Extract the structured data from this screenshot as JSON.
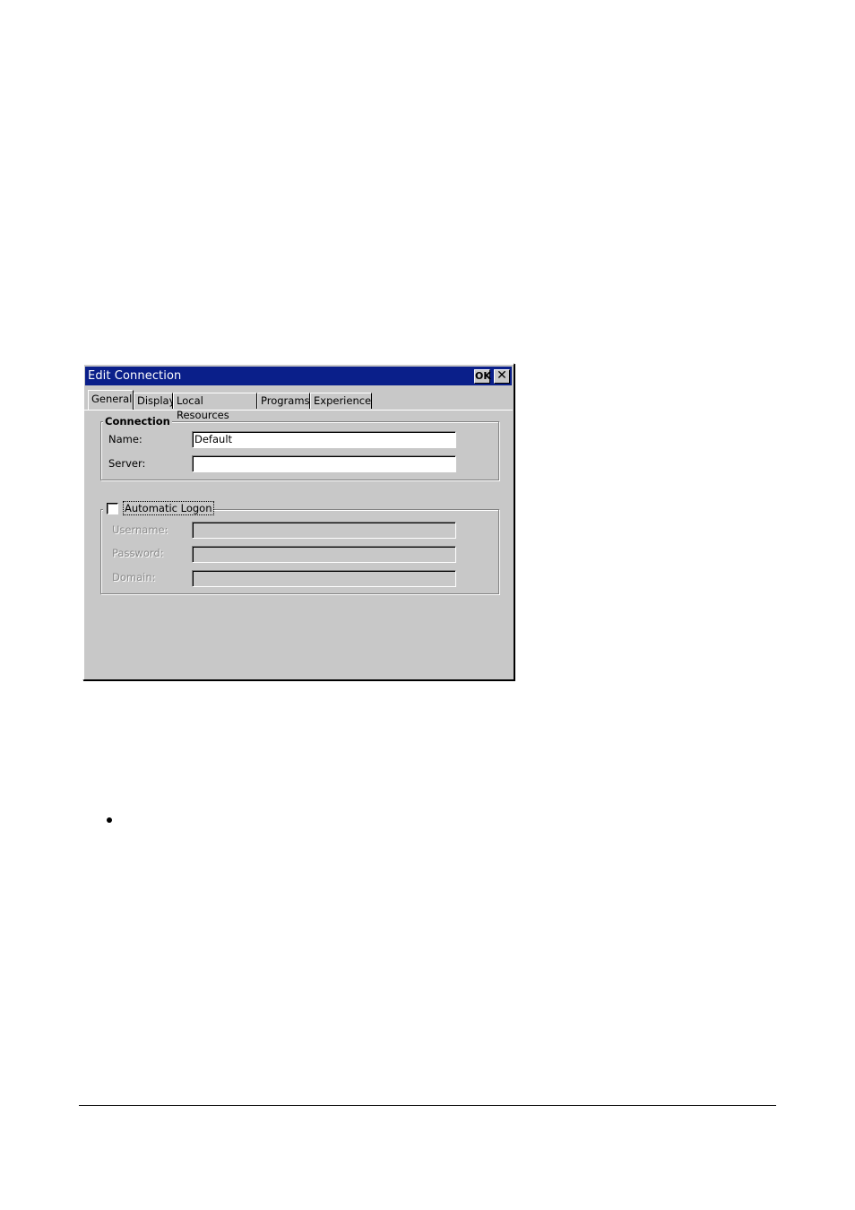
{
  "window": {
    "title": "Edit Connection",
    "ok_label": "OK",
    "close_symbol": "✕"
  },
  "tabs": [
    {
      "label": "General",
      "active": true
    },
    {
      "label": "Display",
      "active": false
    },
    {
      "label": "Local Resources",
      "active": false
    },
    {
      "label": "Programs",
      "active": false
    },
    {
      "label": "Experience",
      "active": false
    }
  ],
  "connection_group": {
    "label": "Connection",
    "name_label": "Name:",
    "name_value": "Default",
    "server_label": "Server:",
    "server_value": ""
  },
  "logon_group": {
    "checkbox_label": "Automatic Logon",
    "checked": false,
    "username_label": "Username:",
    "username_value": "",
    "password_label": "Password:",
    "password_value": "",
    "domain_label": "Domain:",
    "domain_value": ""
  },
  "colors": {
    "titlebar": "#0a1f8a",
    "dialog_bg": "#c8c8c8"
  }
}
